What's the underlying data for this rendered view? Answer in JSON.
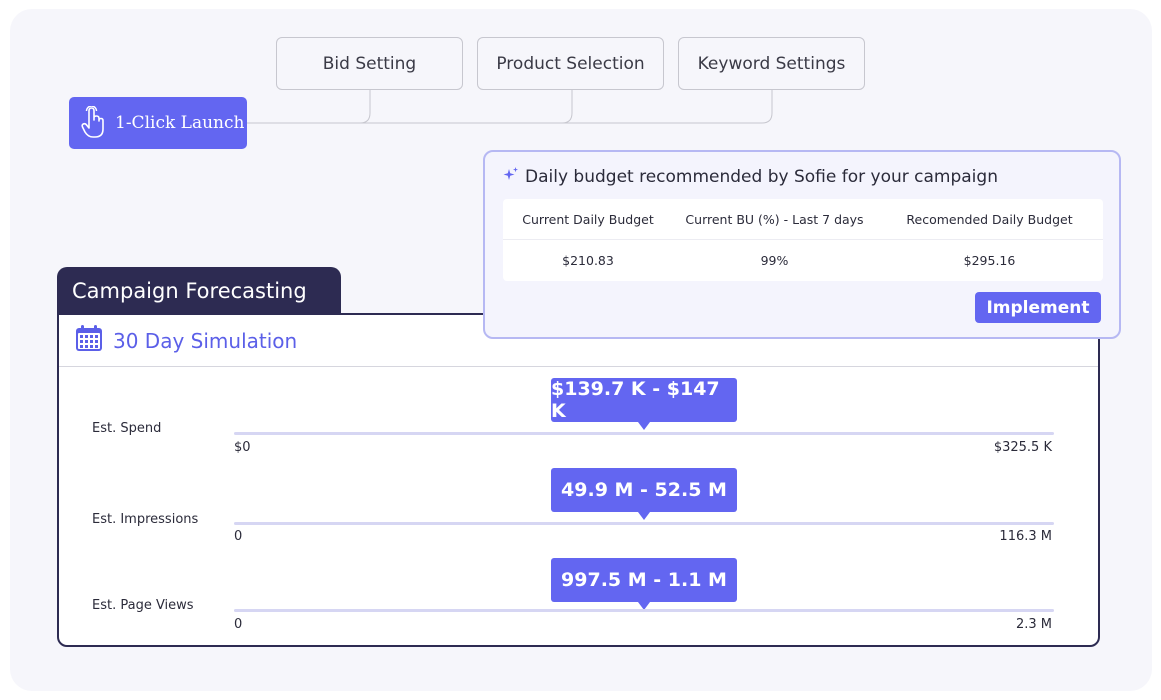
{
  "colors": {
    "accent": "#6366f1",
    "dark": "#2d2b52",
    "border": "#b6b8f3",
    "track": "#d6d6f3"
  },
  "nav": {
    "steps": [
      "Bid Setting",
      "Product Selection",
      "Keyword Settings"
    ],
    "launch_label": "1-Click Launch",
    "launch_icon": "pointer-hand-icon"
  },
  "recommendation": {
    "title": "Daily budget recommended by Sofie for your campaign",
    "title_icon": "sparkle-icon",
    "columns": [
      "Current Daily Budget",
      "Current BU (%) - Last 7 days",
      "Recomended Daily Budget"
    ],
    "values": [
      "$210.83",
      "99%",
      "$295.16"
    ],
    "implement_label": "Implement"
  },
  "forecasting": {
    "tab_label": "Campaign Forecasting",
    "simulation_title": "30 Day Simulation",
    "simulation_icon": "calendar-icon",
    "metrics": [
      {
        "label": "Est. Spend",
        "range": "$139.7 K - $147 K",
        "min": "$0",
        "max": "$325.5 K",
        "marker_fraction": 0.5
      },
      {
        "label": "Est. Impressions",
        "range": "49.9 M - 52.5 M",
        "min": "0",
        "max": "116.3 M",
        "marker_fraction": 0.5
      },
      {
        "label": "Est. Page Views",
        "range": "997.5 M - 1.1 M",
        "min": "0",
        "max": "2.3 M",
        "marker_fraction": 0.5
      }
    ]
  }
}
